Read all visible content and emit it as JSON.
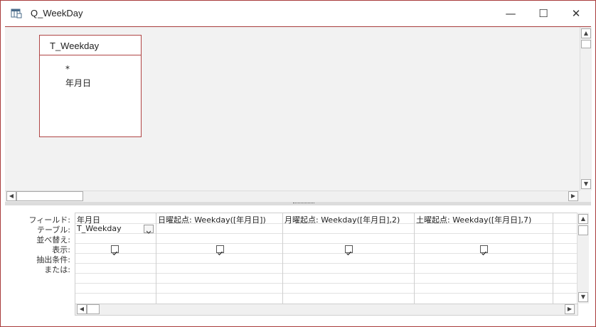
{
  "window": {
    "title": "Q_WeekDay",
    "min_glyph": "—",
    "max_glyph": "☐",
    "close_glyph": "✕"
  },
  "table": {
    "name": "T_Weekday",
    "fields": [
      "*",
      "年月日"
    ]
  },
  "grid": {
    "row_labels": [
      "フィールド:",
      "テーブル:",
      "並べ替え:",
      "表示:",
      "抽出条件:",
      "または:"
    ],
    "columns": [
      {
        "field": "年月日",
        "table": "T_Weekday",
        "show": true
      },
      {
        "field": "日曜起点: Weekday([年月日])",
        "table": "",
        "show": true
      },
      {
        "field": "月曜起点: Weekday([年月日],2)",
        "table": "",
        "show": true
      },
      {
        "field": "土曜起点: Weekday([年月日],7)",
        "table": "",
        "show": true
      },
      {
        "field": "",
        "table": "",
        "show": false
      }
    ]
  },
  "icons": {
    "app": "query-design-icon",
    "scroll_up": "▲",
    "scroll_down": "▼",
    "scroll_left": "◀",
    "scroll_right": "▶",
    "checkmark": "✓"
  }
}
